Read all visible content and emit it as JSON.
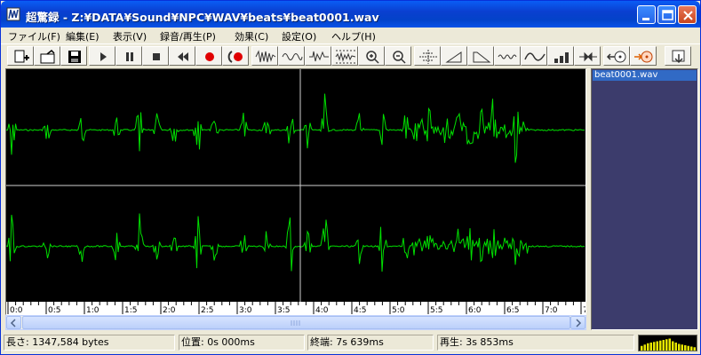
{
  "window": {
    "title": "超驚録 - Z:¥DATA¥Sound¥NPC¥WAV¥beats¥beat0001.wav",
    "minimize_icon": "minimize-icon",
    "maximize_icon": "maximize-icon",
    "close_icon": "close-icon"
  },
  "menu": [
    {
      "label": "ファイル(F)"
    },
    {
      "label": "編集(E)"
    },
    {
      "label": "表示(V)"
    },
    {
      "label": "録音/再生(P)"
    },
    {
      "label": "効果(C)"
    },
    {
      "label": "設定(O)"
    },
    {
      "label": "ヘルプ(H)"
    }
  ],
  "toolbar": {
    "buttons": [
      "new-file-icon",
      "open-folder-icon",
      "save-icon",
      "play-icon",
      "pause-icon",
      "stop-icon",
      "rewind-icon",
      "record-icon",
      "loop-record-icon",
      "waveform-effect-1-icon",
      "waveform-effect-2-icon",
      "waveform-effect-3-icon",
      "waveform-effect-4-icon",
      "zoom-in-icon",
      "zoom-out-icon",
      "normalize-icon",
      "fade-in-icon",
      "fade-out-icon",
      "noise-icon",
      "wave-icon",
      "levels-icon",
      "trim-icon",
      "cd-read-icon",
      "cd-write-icon",
      "export-icon"
    ]
  },
  "timeline": {
    "ticks": [
      "0:0",
      "0:5",
      "1:0",
      "1:5",
      "2:0",
      "2:5",
      "3:0",
      "3:5",
      "4:0",
      "4:5",
      "5:0",
      "5:5",
      "6:0",
      "6:5",
      "7:0",
      "7:"
    ]
  },
  "file_list": {
    "items": [
      {
        "name": "beat0001.wav",
        "selected": true
      }
    ]
  },
  "status": {
    "length": "長さ: 1347,584 bytes",
    "position": "位置: 0s 000ms",
    "end": "終端: 7s 639ms",
    "playback": "再生: 3s 853ms"
  },
  "colors": {
    "waveform": "#00E000",
    "background": "#000000",
    "divider": "#D0D0D0",
    "file_list_bg": "#3C3C6C",
    "selection": "#316AC5"
  },
  "level_meter": {
    "levels": [
      0.35,
      0.45,
      0.55,
      0.6,
      0.65,
      0.7,
      0.75,
      0.8,
      0.85,
      0.9,
      0.7,
      0.6,
      0.5,
      0.45,
      0.4,
      0.35,
      0.3,
      0.25
    ]
  }
}
